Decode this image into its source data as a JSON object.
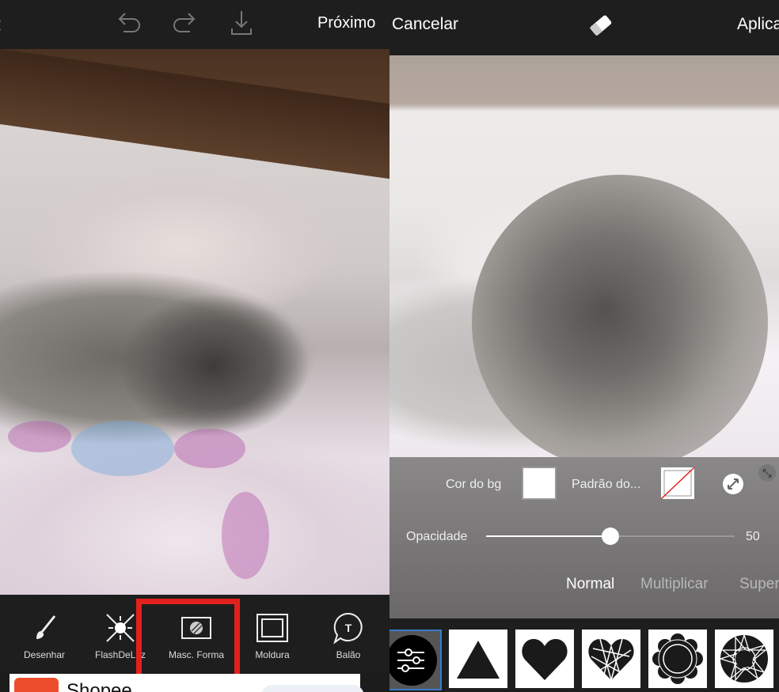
{
  "left": {
    "topbar": {
      "next_label": "Próximo"
    },
    "tools": [
      {
        "label": "Desenhar",
        "icon": "brush-icon"
      },
      {
        "label": "FlashDeLuz",
        "icon": "flash-icon"
      },
      {
        "label": "Masc. Forma",
        "icon": "shape-mask-icon"
      },
      {
        "label": "Moldura",
        "icon": "frame-icon"
      },
      {
        "label": "Balão",
        "icon": "speech-balloon-icon"
      }
    ],
    "highlight_color": "#e3211c",
    "ad": {
      "title": "Shopee",
      "brand_color": "#ee4d2d"
    }
  },
  "right": {
    "topbar": {
      "cancel_label": "Cancelar",
      "apply_label": "Aplicar"
    },
    "controls": {
      "bg_color_label": "Cor do bg",
      "pattern_label": "Padrão do...",
      "opacity_label": "Opacidade",
      "opacity_value": "50",
      "opacity_percent": 50,
      "blend_modes": [
        "Normal",
        "Multiplicar",
        "Super"
      ],
      "selected_blend": "Normal"
    },
    "shapes": [
      "settings",
      "triangle",
      "heart",
      "geometric-heart",
      "flower-circle",
      "star-circle"
    ]
  }
}
